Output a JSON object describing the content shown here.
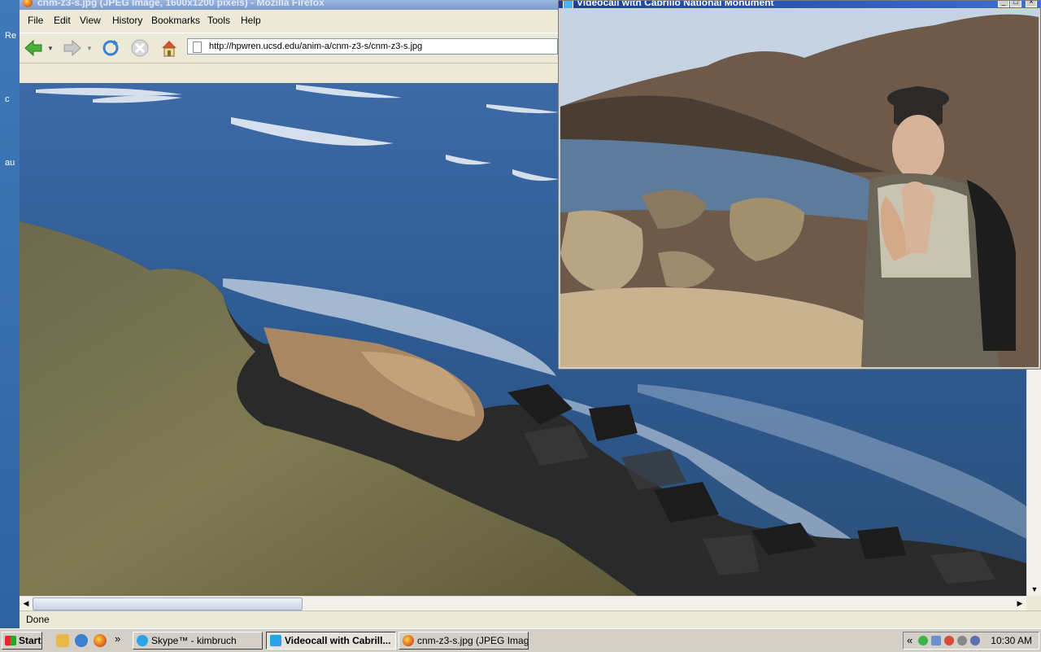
{
  "desktop": {
    "icon_labels": [
      "Re",
      "c",
      "au"
    ]
  },
  "firefox": {
    "title": "cnm-z3-s.jpg (JPEG Image, 1600x1200 pixels) - Mozilla Firefox",
    "menu": [
      "File",
      "Edit",
      "View",
      "History",
      "Bookmarks",
      "Tools",
      "Help"
    ],
    "url": "http://hpwren.ucsd.edu/anim-a/cnm-z3-s/cnm-z3-s.jpg",
    "status": "Done"
  },
  "videocall": {
    "title": "Videocall with Cabrillo National Monument"
  },
  "taskbar": {
    "start_label": "Start",
    "quicklaunch_more": "»",
    "buttons": [
      {
        "label": "Skype™ - kimbruch",
        "icon": "skype-icon"
      },
      {
        "label": "Videocall with Cabrill...",
        "icon": "skype-video-icon"
      },
      {
        "label": "cnm-z3-s.jpg (JPEG Imag...",
        "icon": "firefox-icon"
      }
    ],
    "tray_expand": "«",
    "clock": "10:30 AM"
  },
  "colors": {
    "titlebar_active": "#1a3f9a",
    "titlebar_inactive": "#7b99c9",
    "chrome": "#ece9d8"
  }
}
